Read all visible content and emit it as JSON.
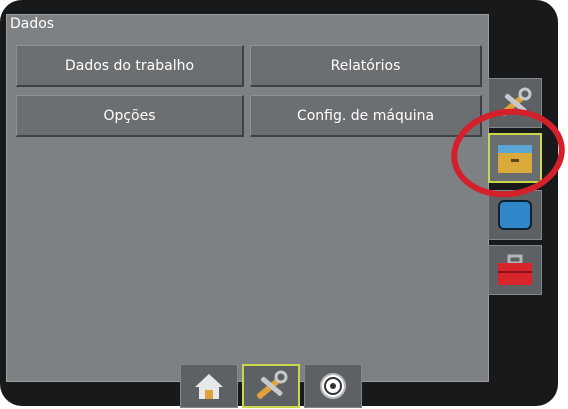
{
  "panel": {
    "title": "Dados"
  },
  "buttons": {
    "job_data": "Dados do trabalho",
    "reports": "Relatórios",
    "options": "Opções",
    "machine_config": "Config. de máquina"
  },
  "side_rail": {
    "items": [
      {
        "icon": "tools-icon"
      },
      {
        "icon": "data-folder-icon",
        "selected": true
      },
      {
        "icon": "console-icon"
      },
      {
        "icon": "toolbox-icon"
      }
    ]
  },
  "bottom_bar": {
    "items": [
      {
        "icon": "home-icon"
      },
      {
        "icon": "tools-icon",
        "selected": true
      },
      {
        "icon": "gauge-icon"
      }
    ]
  },
  "colors": {
    "accent_selected": "#c8d84a",
    "highlight": "#d4202a",
    "panel": "#7e8184",
    "button": "#6c6f72"
  }
}
